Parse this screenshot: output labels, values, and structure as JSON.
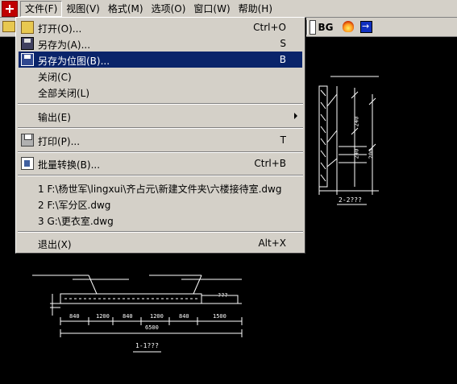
{
  "menubar": {
    "items": [
      "文件(F)",
      "视图(V)",
      "格式(M)",
      "选项(O)",
      "窗口(W)",
      "帮助(H)"
    ]
  },
  "toolbar": {
    "bg_label": "BG"
  },
  "file_menu": {
    "open": {
      "label": "打开(O)...",
      "shortcut": "Ctrl+O"
    },
    "save_as": {
      "label": "另存为(A)...",
      "shortcut": "S"
    },
    "save_as_bitmap": {
      "label": "另存为位图(B)...",
      "shortcut": "B"
    },
    "close": {
      "label": "关闭(C)"
    },
    "close_all": {
      "label": "全部关闭(L)"
    },
    "output": {
      "label": "输出(E)"
    },
    "print": {
      "label": "打印(P)...",
      "shortcut": "T"
    },
    "batch_convert": {
      "label": "批量转换(B)...",
      "shortcut": "Ctrl+B"
    },
    "recent_files": [
      "1 F:\\杨世军\\lingxui\\齐占元\\新建文件夹\\六楼接待室.dwg",
      "2 F:\\军分区.dwg",
      "3 G:\\更衣室.dwg"
    ],
    "exit": {
      "label": "退出(X)",
      "shortcut": "Alt+X"
    }
  },
  "drawing": {
    "section_right_label": "2-2???",
    "section_bottom_label": "1-1???",
    "dims_bottom": [
      "840",
      "1200",
      "840",
      "1200",
      "840",
      "1500"
    ],
    "dim_total": "6500",
    "dim_right_vertical": [
      "240",
      "240",
      "200"
    ],
    "side_text": "???"
  }
}
